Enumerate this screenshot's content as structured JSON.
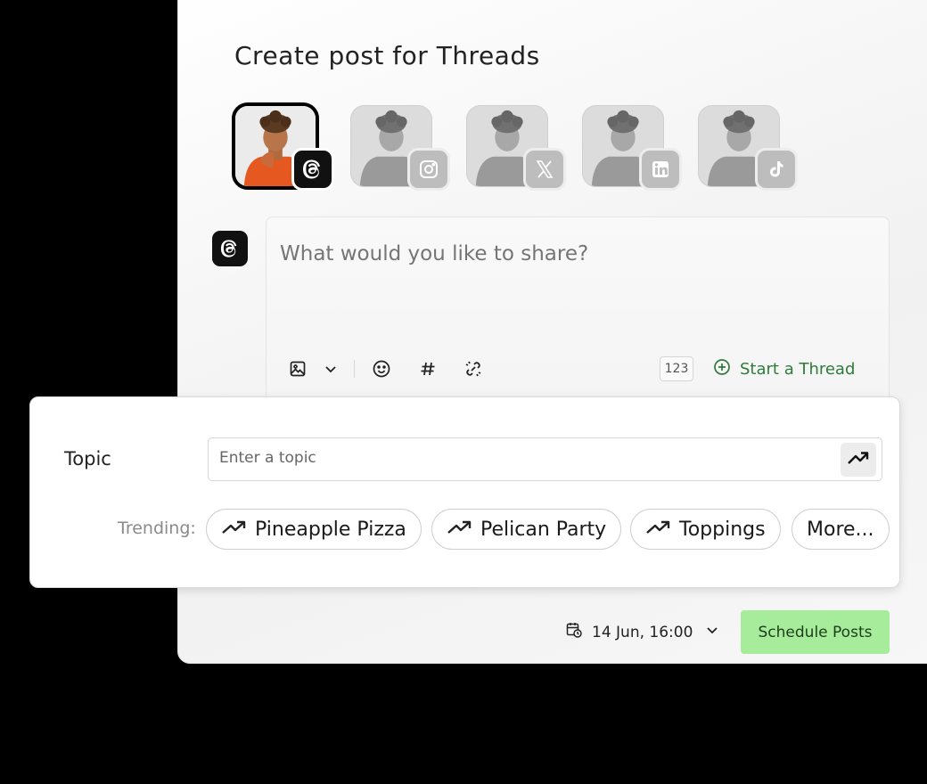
{
  "page": {
    "title": "Create post for Threads"
  },
  "accounts": [
    {
      "name": "threads-account",
      "network": "threads-icon",
      "active": true
    },
    {
      "name": "instagram-account",
      "network": "instagram-icon",
      "active": false
    },
    {
      "name": "x-account",
      "network": "x-icon",
      "active": false
    },
    {
      "name": "linkedin-account",
      "network": "linkedin-icon",
      "active": false
    },
    {
      "name": "tiktok-account",
      "network": "tiktok-icon",
      "active": false
    }
  ],
  "editor": {
    "placeholder": "What would you like to share?",
    "char_count": "123",
    "start_thread_label": "Start a Thread"
  },
  "topic": {
    "label": "Topic",
    "placeholder": "Enter a topic",
    "trending_label": "Trending:",
    "chips": [
      "Pineapple Pizza",
      "Pelican Party",
      "Toppings",
      "More..."
    ]
  },
  "footer": {
    "date": "14 Jun, 16:00",
    "schedule_label": "Schedule Posts"
  },
  "colors": {
    "accent_green": "#2f7a3c",
    "schedule_bg": "#a6ec9b",
    "avatar_orange": "#e5581f"
  }
}
